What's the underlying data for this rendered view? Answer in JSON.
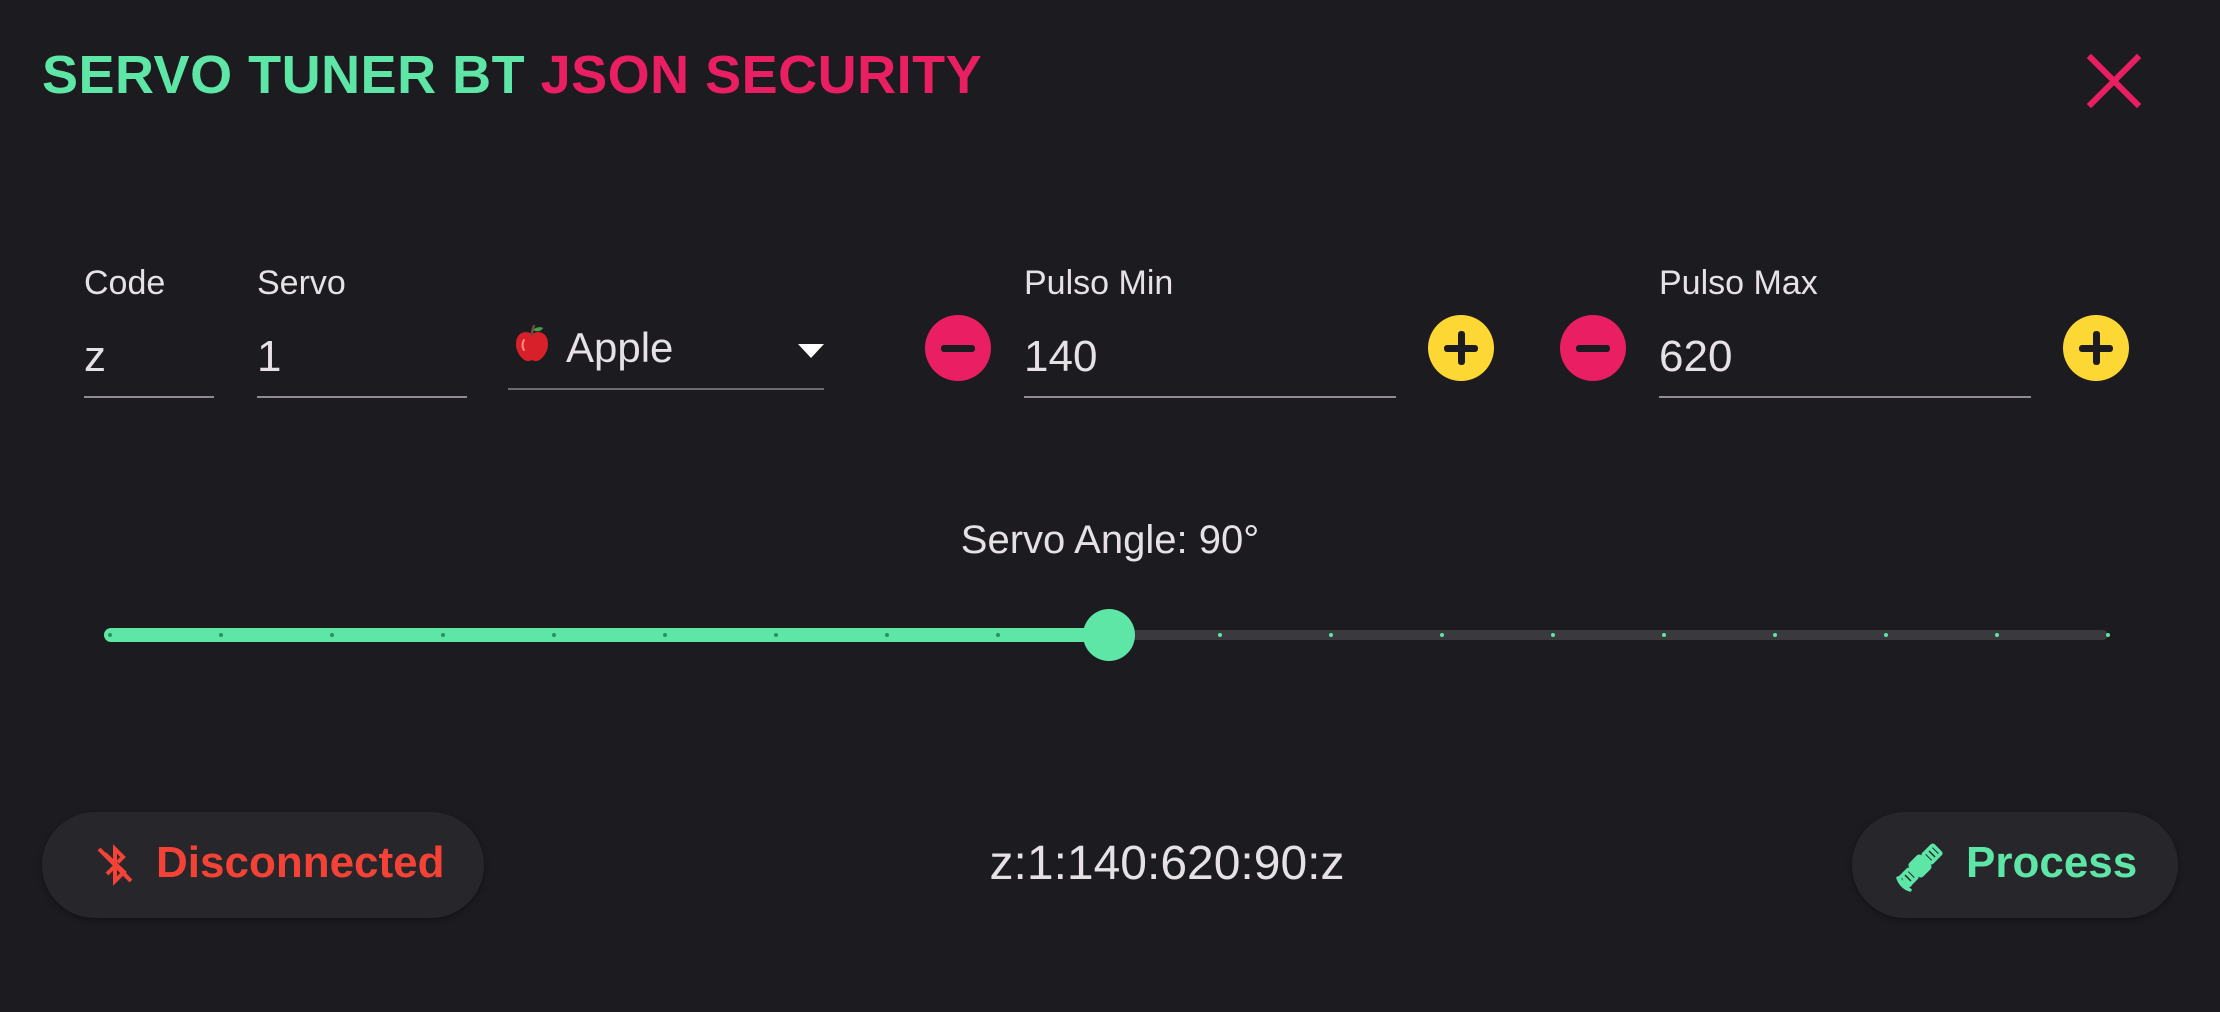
{
  "header": {
    "title_part1": "SERVO TUNER BT",
    "title_part2": "JSON SECURITY",
    "title_color1": "#5ee6a6",
    "title_color2": "#e91e63",
    "close_icon": "close-icon"
  },
  "fields": {
    "code": {
      "label": "Code",
      "value": "z"
    },
    "servo": {
      "label": "Servo",
      "value": "1"
    },
    "fruit": {
      "selected": "Apple",
      "icon": "apple-emoji"
    },
    "pulse_min": {
      "label": "Pulso Min",
      "value": "140"
    },
    "pulse_max": {
      "label": "Pulso Max",
      "value": "620"
    }
  },
  "slider": {
    "label": "Servo Angle: 90°",
    "value": 90,
    "min": 0,
    "max": 180,
    "divisions": 18,
    "active_color": "#5ee6a6",
    "inactive_color": "#3a393e"
  },
  "footer": {
    "status_label": "Disconnected",
    "status_icon": "bluetooth-disabled-icon",
    "status_color": "#f44336",
    "command_string": "z:1:140:620:90:z",
    "process_label": "Process",
    "process_icon": "satellite-icon",
    "process_color": "#5ee6a6"
  },
  "colors": {
    "background": "#1c1b1f",
    "minus_button": "#e91e63",
    "plus_button": "#fdd835"
  }
}
